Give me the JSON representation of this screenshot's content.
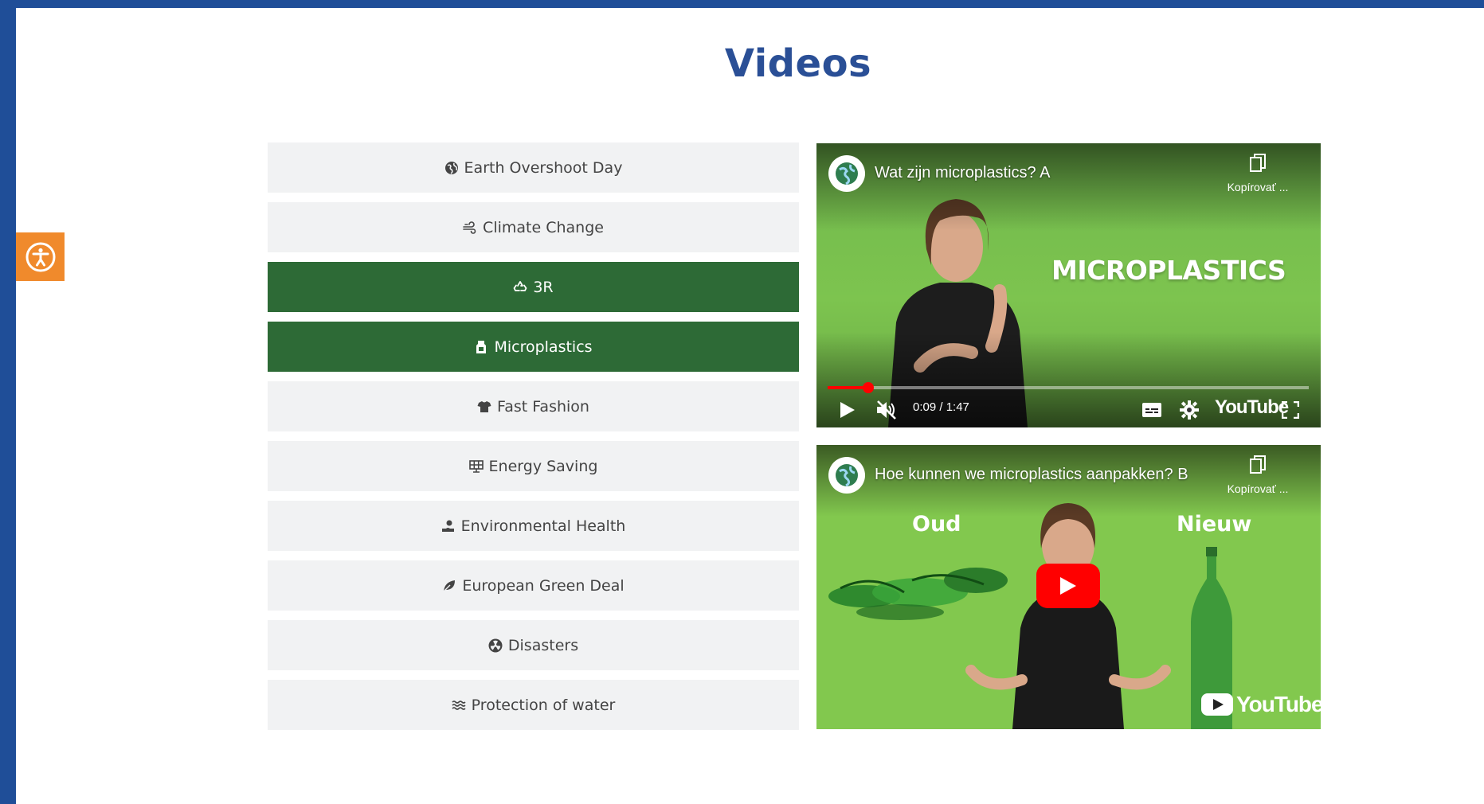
{
  "page": {
    "title": "Videos"
  },
  "colors": {
    "frame": "#1f4e98",
    "title": "#2a4f96",
    "tab_inactive": "#f1f2f3",
    "tab_active": "#2d6a36",
    "accessibility": "#f08a2c",
    "youtube_red": "#ff0000"
  },
  "accessibility": {
    "icon": "accessibility-icon"
  },
  "tabs": [
    {
      "label": "Earth Overshoot Day",
      "icon": "earth-icon",
      "active": false
    },
    {
      "label": "Climate Change",
      "icon": "wind-icon",
      "active": false
    },
    {
      "label": "3R",
      "icon": "recycle-icon",
      "active": true
    },
    {
      "label": "Microplastics",
      "icon": "bottle-icon",
      "active": true
    },
    {
      "label": "Fast Fashion",
      "icon": "tshirt-icon",
      "active": false
    },
    {
      "label": "Energy Saving",
      "icon": "solar-panel-icon",
      "active": false
    },
    {
      "label": "Environmental Health",
      "icon": "hand-heart-icon",
      "active": false
    },
    {
      "label": "European Green Deal",
      "icon": "leaf-icon",
      "active": false
    },
    {
      "label": "Disasters",
      "icon": "radiation-icon",
      "active": false
    },
    {
      "label": "Protection of water",
      "icon": "water-icon",
      "active": false
    }
  ],
  "videos": [
    {
      "title": "Wat zijn microplastics? A",
      "copy_label": "Kopírovať ...",
      "overlay_text": "MICROPLASTICS",
      "time": "0:09 / 1:47",
      "progress": 0.085,
      "brand": "YouTube"
    },
    {
      "title": "Hoe kunnen we microplastics aanpakken? B",
      "copy_label": "Kopírovať ...",
      "label_left": "Oud",
      "label_right": "Nieuw",
      "brand": "YouTube"
    }
  ]
}
